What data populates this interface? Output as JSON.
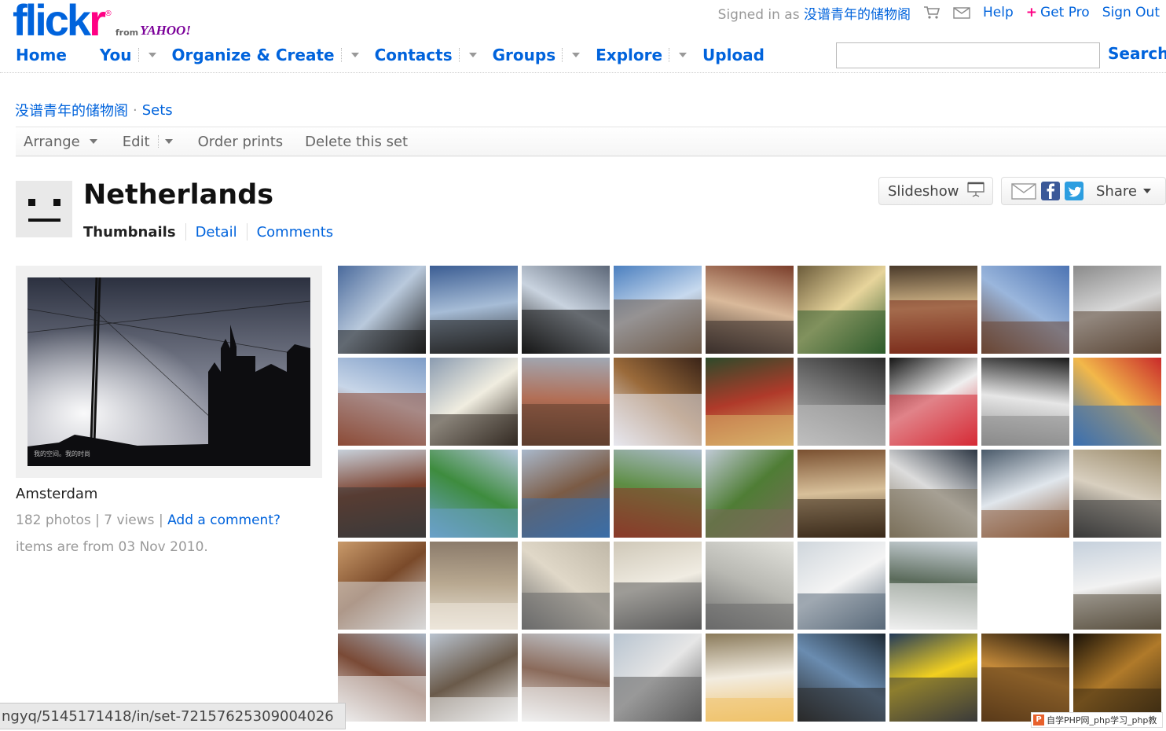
{
  "header": {
    "logo": {
      "brand": "flickr",
      "reg": "®",
      "from": "from",
      "partner": "YAHOO!"
    },
    "signed_in_prefix": "Signed in as",
    "username": "没谱青年的储物阁",
    "links": {
      "help": "Help",
      "get_pro": "Get Pro",
      "get_pro_plus": "+",
      "sign_out": "Sign Out"
    },
    "icons": [
      "cart-icon",
      "mail-icon"
    ]
  },
  "nav": {
    "home": "Home",
    "you": "You",
    "organize": "Organize & Create",
    "contacts": "Contacts",
    "groups": "Groups",
    "explore": "Explore",
    "upload": "Upload"
  },
  "search": {
    "value": "",
    "button": "Search"
  },
  "breadcrumb": {
    "owner": "没谱青年的储物阁",
    "separator": "·",
    "sets": "Sets"
  },
  "actions": {
    "arrange": "Arrange",
    "edit": "Edit",
    "order_prints": "Order prints",
    "delete": "Delete this set"
  },
  "set": {
    "title": "Netherlands",
    "tabs": {
      "thumbnails": "Thumbnails",
      "detail": "Detail",
      "comments": "Comments"
    },
    "slideshow": "Slideshow",
    "share": "Share",
    "name": "Amsterdam",
    "photos": "182 photos",
    "views": "7 views",
    "add_comment": "Add a comment?",
    "dates": "items are from 03 Nov 2010.",
    "feature_caption": "我的空间。我的时尚"
  },
  "thumbnails": [
    {
      "palette": [
        "#4a6a9c",
        "#b9c9dc",
        "#1b1b1b"
      ]
    },
    {
      "palette": [
        "#3b5d93",
        "#a6bcd6",
        "#222222"
      ]
    },
    {
      "palette": [
        "#5c6778",
        "#c9d3df",
        "#161616"
      ]
    },
    {
      "palette": [
        "#4b7fbf",
        "#c7d9ee",
        "#6e5a49"
      ]
    },
    {
      "palette": [
        "#7a3d2a",
        "#d9b99a",
        "#3a2f2b"
      ]
    },
    {
      "palette": [
        "#6b5b3a",
        "#e7d49b",
        "#2e5b2b"
      ]
    },
    {
      "palette": [
        "#4a3a2a",
        "#d6b98a",
        "#7a2a1a"
      ]
    },
    {
      "palette": [
        "#4d74b3",
        "#9ab6dc",
        "#6a4633"
      ]
    },
    {
      "palette": [
        "#8a8a8a",
        "#d8d8d8",
        "#5a4535"
      ]
    },
    {
      "palette": [
        "#7d9cc7",
        "#c8d6e8",
        "#8c4b36"
      ]
    },
    {
      "palette": [
        "#8a9bb0",
        "#f0ede0",
        "#332a22"
      ]
    },
    {
      "palette": [
        "#a0a8b4",
        "#b26e55",
        "#5e3e2e"
      ]
    },
    {
      "palette": [
        "#3a2418",
        "#9a6a3a",
        "#e7e7ef"
      ]
    },
    {
      "palette": [
        "#2e4a2a",
        "#b03a2a",
        "#d8b26a"
      ]
    },
    {
      "palette": [
        "#2a2a2a",
        "#777777",
        "#bfbfbf"
      ]
    },
    {
      "palette": [
        "#151515",
        "#efefef",
        "#d62a35"
      ]
    },
    {
      "palette": [
        "#191919",
        "#e6e6e6",
        "#8a8a8a"
      ]
    },
    {
      "palette": [
        "#c92a2a",
        "#f2b84a",
        "#3a6fb0"
      ]
    },
    {
      "palette": [
        "#c7d0da",
        "#7a3e2a",
        "#3a3a3a"
      ]
    },
    {
      "palette": [
        "#b3c6dc",
        "#3e8c3e",
        "#6aa0c8"
      ]
    },
    {
      "palette": [
        "#a9b8cb",
        "#7b5b45",
        "#3a6ea8"
      ]
    },
    {
      "palette": [
        "#adbccd",
        "#5e8e44",
        "#8a3a2a"
      ]
    },
    {
      "palette": [
        "#c0cad6",
        "#4f7d35",
        "#7a6a5a"
      ]
    },
    {
      "palette": [
        "#7a5030",
        "#d8c09a",
        "#3a2a1a"
      ]
    },
    {
      "palette": [
        "#2d3744",
        "#dcdcdc",
        "#7a6f5a"
      ]
    },
    {
      "palette": [
        "#4a5a6a",
        "#e0e6ec",
        "#8a5a3a"
      ]
    },
    {
      "palette": [
        "#9a8a6a",
        "#d8cfbf",
        "#3a3a3a"
      ]
    },
    {
      "palette": [
        "#c99a6a",
        "#7a4a2a",
        "#d8d8d8"
      ]
    },
    {
      "palette": [
        "#8a7a6a",
        "#b8a890",
        "#ece6da"
      ]
    },
    {
      "palette": [
        "#c0b8a8",
        "#e0d8c8",
        "#6a6a6a"
      ]
    },
    {
      "palette": [
        "#cfc8b8",
        "#f0ece2",
        "#5a5a5a"
      ]
    },
    {
      "palette": [
        "#e2e2dc",
        "#b8b8b2",
        "#6a6a6a"
      ]
    },
    {
      "palette": [
        "#cfd6dc",
        "#f4f4f4",
        "#5a6a7a"
      ]
    },
    {
      "palette": [
        "#cdd5dc",
        "#5a6a5a",
        "#f0f0f0"
      ]
    },
    {
      "palette": [
        "#ffffff",
        "#ffffff",
        "#ffffff"
      ]
    },
    {
      "palette": [
        "#c5d0dc",
        "#f2f2f2",
        "#5a5040"
      ]
    },
    {
      "palette": [
        "#a9b5c3",
        "#7a4a36",
        "#efefef"
      ]
    },
    {
      "palette": [
        "#b9c3cf",
        "#6a5a4a",
        "#ececec"
      ]
    },
    {
      "palette": [
        "#c5ccd4",
        "#8a6a5a",
        "#f0f0f0"
      ]
    },
    {
      "palette": [
        "#b8c4d0",
        "#e6e6e6",
        "#5a5a5a"
      ]
    },
    {
      "palette": [
        "#8a7a5a",
        "#f2ece0",
        "#f0c26a"
      ]
    },
    {
      "palette": [
        "#1e2a34",
        "#6a8cb0",
        "#2a2a2a"
      ]
    },
    {
      "palette": [
        "#223a5a",
        "#f2d020",
        "#3a3a3a"
      ]
    },
    {
      "palette": [
        "#1a120a",
        "#c48a3a",
        "#5a3a1a"
      ]
    },
    {
      "palette": [
        "#1a1208",
        "#b07a2a",
        "#3a2a12"
      ]
    }
  ],
  "status_url": "ngyq/5145171418/in/set-72157625309004026",
  "watermark": {
    "badge": "P",
    "text": "自学PHP网_php学习_php教"
  }
}
